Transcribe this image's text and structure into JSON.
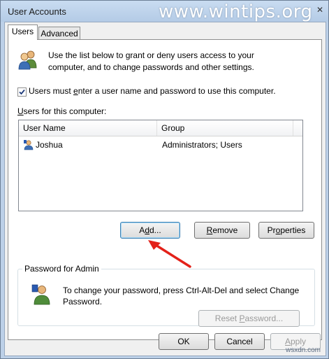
{
  "window": {
    "title": "User Accounts",
    "watermark": "www.wintips.org",
    "close_glyph": "✕"
  },
  "tabs": [
    {
      "label": "Users",
      "mnemonic": "",
      "active": true
    },
    {
      "label": "Advanced",
      "active": false
    }
  ],
  "intro": {
    "icon": "users-group-icon",
    "text": "Use the list below to grant or deny users access to your computer, and to change passwords and other settings."
  },
  "require_login": {
    "checked": true,
    "label_pre": "Users must ",
    "label_mnemonic": "e",
    "label_post": "nter a user name and password to use this computer."
  },
  "users_list": {
    "label_mnemonic": "U",
    "label_rest": "sers for this computer:",
    "columns": [
      "User Name",
      "Group"
    ],
    "rows": [
      {
        "user": "Joshua",
        "group": "Administrators; Users",
        "icon": "user-icon"
      }
    ]
  },
  "buttons": {
    "add_pre": "A",
    "add_mnemonic": "d",
    "add_post": "d...",
    "remove_mnemonic": "R",
    "remove_rest": "emove",
    "properties_pre": "Pr",
    "properties_mnemonic": "o",
    "properties_post": "perties"
  },
  "password_group": {
    "label": "Password for Admin",
    "icon": "user-password-icon",
    "text": "To change your password, press Ctrl-Alt-Del and select Change Password.",
    "reset_pre": "Reset ",
    "reset_mnemonic": "P",
    "reset_post": "assword..."
  },
  "dialog_buttons": {
    "ok": "OK",
    "cancel": "Cancel",
    "apply_mnemonic": "A",
    "apply_rest": "pply"
  },
  "annotation": {
    "arrow_color": "#e32119"
  },
  "watermark_bottom": "wsxdn.com"
}
